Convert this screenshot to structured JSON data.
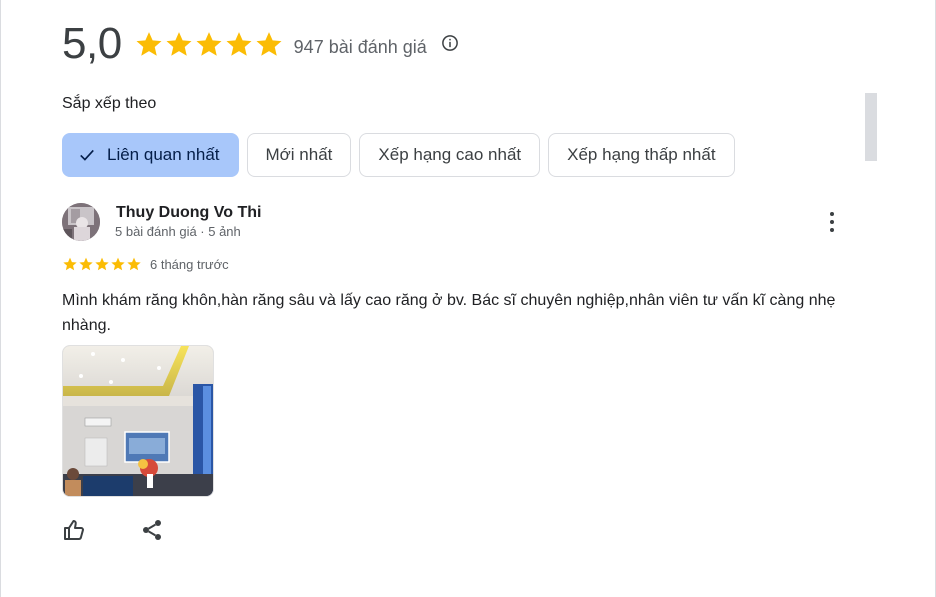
{
  "summary": {
    "rating": "5,0",
    "stars": 5,
    "review_count": "947 bài đánh giá",
    "star_color": "#fbbc04"
  },
  "sort": {
    "label": "Sắp xếp theo",
    "chips": [
      {
        "label": "Liên quan nhất",
        "selected": true
      },
      {
        "label": "Mới nhất",
        "selected": false
      },
      {
        "label": "Xếp hạng cao nhất",
        "selected": false
      },
      {
        "label": "Xếp hạng thấp nhất",
        "selected": false
      }
    ]
  },
  "review": {
    "reviewer_name": "Thuy Duong Vo Thi",
    "reviewer_meta": "5 bài đánh giá · 5 ảnh",
    "stars": 5,
    "time": "6 tháng trước",
    "text": "Mình khám răng khôn,hàn răng sâu và lấy cao răng ở bv. Bác sĩ chuyên nghiệp,nhân viên tư vấn kĩ càng nhẹ nhàng.",
    "photo_icon": "clinic-photo"
  },
  "icons": {
    "info": "info-icon",
    "check": "check-icon",
    "more": "more-vert-icon",
    "like": "thumb-up-icon",
    "share": "share-icon"
  }
}
